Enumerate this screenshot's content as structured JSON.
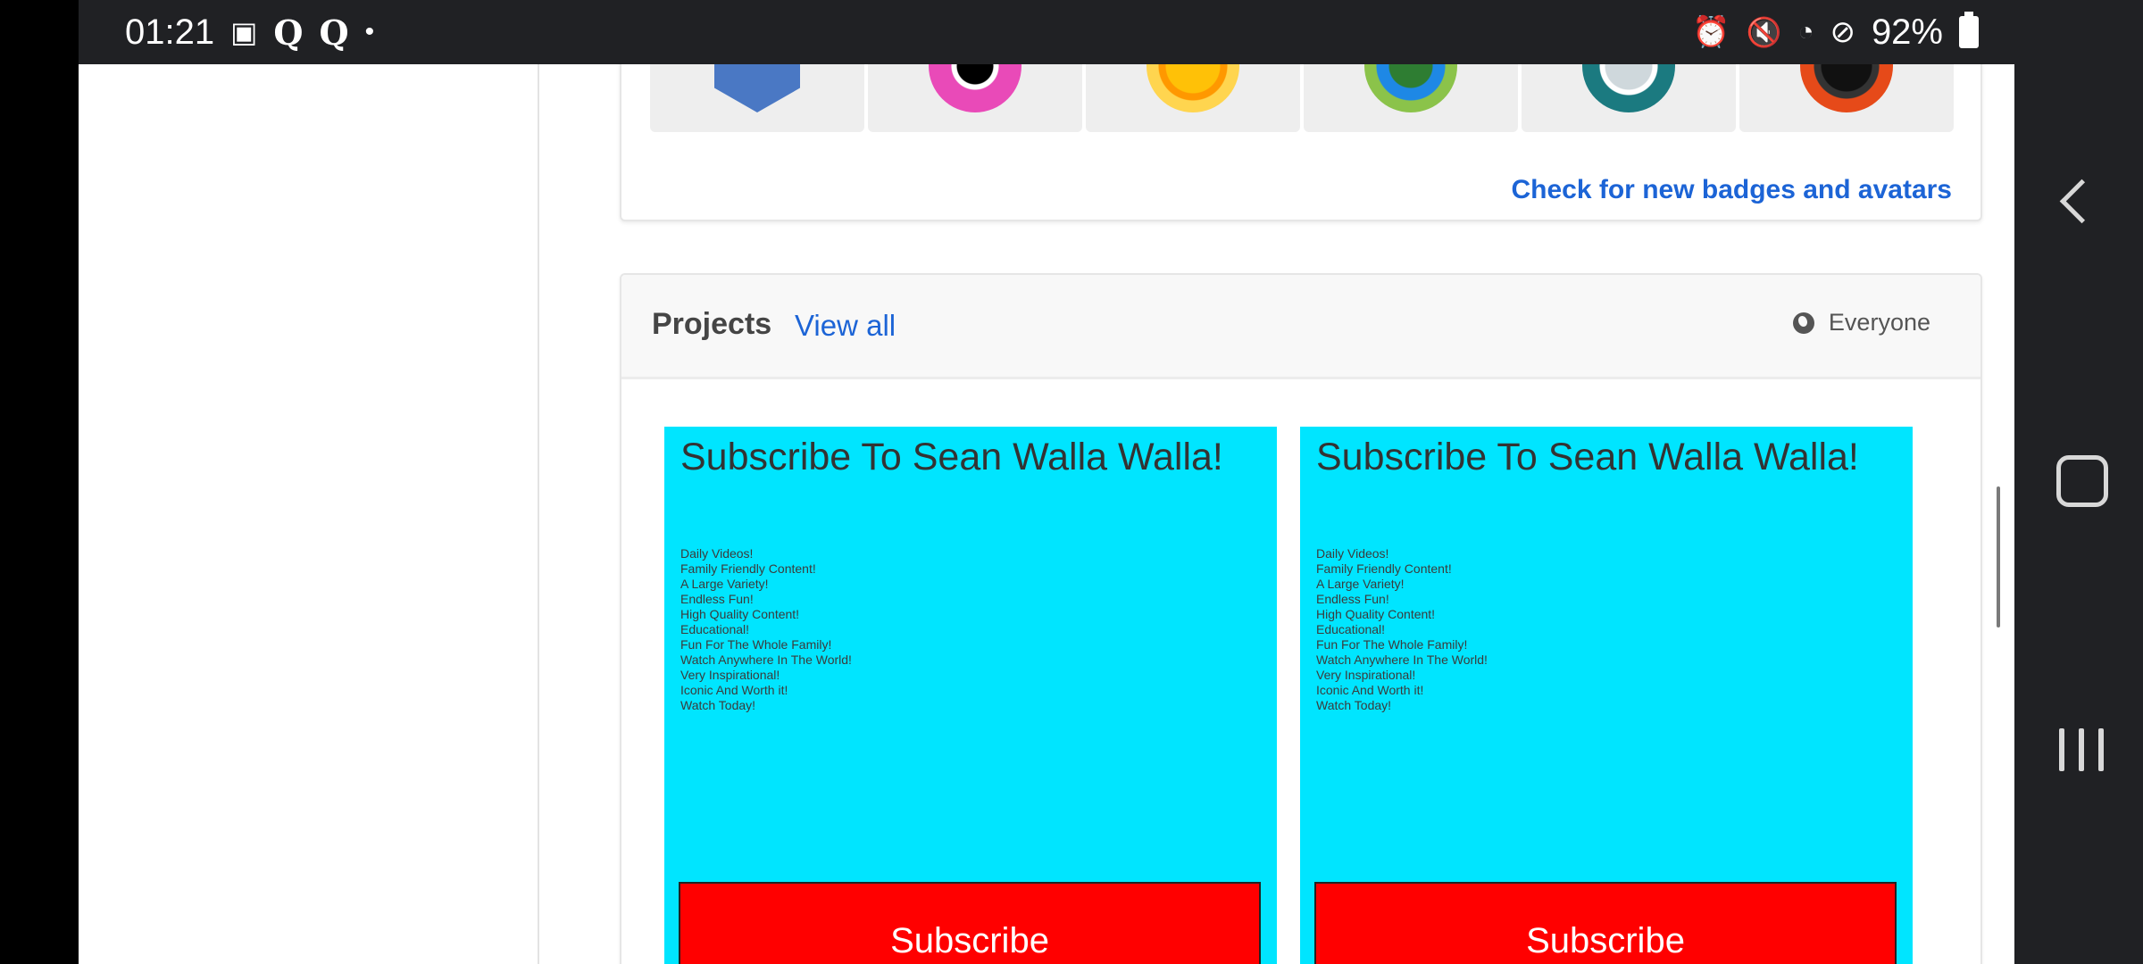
{
  "status_bar": {
    "time": "01:21",
    "notification_icons": [
      "image-icon",
      "quora-icon",
      "quora-icon",
      "dot-icon"
    ],
    "q1": "Q",
    "q2": "Q",
    "dot": "•",
    "battery": "92%",
    "system_icons": [
      "alarm-icon",
      "mute-icon",
      "wifi-icon",
      "do-not-disturb-icon",
      "battery-icon"
    ]
  },
  "badges": {
    "items": [
      "shield-badge",
      "ring-badge",
      "sun-badge",
      "globe-badge",
      "moon-badge",
      "planet-badge"
    ],
    "check_link": "Check for new badges and avatars"
  },
  "projects": {
    "title": "Projects",
    "view_all": "View all",
    "privacy": "Everyone",
    "items": [
      {
        "title": "Subscribe To Sean Walla Walla!",
        "list": "Daily Videos!\nFamily Friendly Content!\nA Large Variety!\nEndless Fun!\nHigh Quality Content!\nEducational!\nFun For The Whole Family!\nWatch Anywhere In The World!\nVery Inspirational!\nIconic And Worth it!\nWatch Today!",
        "button": "Subscribe"
      },
      {
        "title": "Subscribe To Sean Walla Walla!",
        "list": "Daily Videos!\nFamily Friendly Content!\nA Large Variety!\nEndless Fun!\nHigh Quality Content!\nEducational!\nFun For The Whole Family!\nWatch Anywhere In The World!\nVery Inspirational!\nIconic And Worth it!\nWatch Today!",
        "button": "Subscribe"
      }
    ]
  },
  "colors": {
    "thumbnail_bg": "#00e5ff",
    "subscribe_bg": "#ff0000",
    "link": "#1c64d6"
  }
}
